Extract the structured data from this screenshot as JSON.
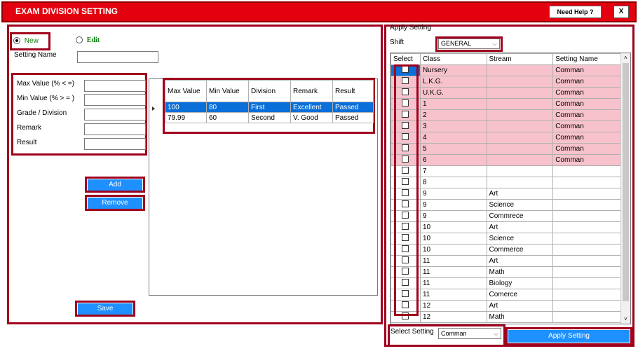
{
  "window": {
    "title": "EXAM DIVISION SETTING",
    "help_label": "Need Help ?",
    "close_label": "X"
  },
  "mode": {
    "new_label": "New",
    "edit_label": "Edit"
  },
  "form": {
    "setting_name_label": "Setting Name",
    "max_value_label": "Max Value  (% < =)",
    "min_value_label": "Min Value   (% > = )",
    "grade_label": "Grade / Division",
    "remark_label": "Remark",
    "result_label": "Result",
    "add_label": "Add",
    "remove_label": "Remove",
    "save_label": "Save"
  },
  "grade_table": {
    "headers": [
      "Max Value",
      "Min Value",
      "Division",
      "Remark",
      "Result"
    ],
    "rows": [
      [
        "100",
        "80",
        "First",
        "Excellent",
        "Passed"
      ],
      [
        "79.99",
        "60",
        "Second",
        "V. Good",
        "Passed"
      ]
    ]
  },
  "apply": {
    "section_label": "Apply Setting",
    "shift_label": "Shift",
    "shift_value": "GENERAL",
    "headers": [
      "Select",
      "Class",
      "Stream",
      "Setting Name"
    ],
    "rows": [
      [
        "Nursery",
        "",
        "Comman"
      ],
      [
        "L.K.G.",
        "",
        "Comman"
      ],
      [
        "U.K.G.",
        "",
        "Comman"
      ],
      [
        "1",
        "",
        "Comman"
      ],
      [
        "2",
        "",
        "Comman"
      ],
      [
        "3",
        "",
        "Comman"
      ],
      [
        "4",
        "",
        "Comman"
      ],
      [
        "5",
        "",
        "Comman"
      ],
      [
        "6",
        "",
        "Comman"
      ],
      [
        "7",
        "",
        ""
      ],
      [
        "8",
        "",
        ""
      ],
      [
        "9",
        "Art",
        ""
      ],
      [
        "9",
        "Science",
        ""
      ],
      [
        "9",
        "Commrece",
        ""
      ],
      [
        "10",
        "Art",
        ""
      ],
      [
        "10",
        "Science",
        ""
      ],
      [
        "10",
        "Commerce",
        ""
      ],
      [
        "11",
        "Art",
        ""
      ],
      [
        "11",
        "Math",
        ""
      ],
      [
        "11",
        "Biology",
        ""
      ],
      [
        "11",
        "Comerce",
        ""
      ],
      [
        "12",
        "Art",
        ""
      ],
      [
        "12",
        "Math",
        ""
      ]
    ],
    "select_setting_label": "Select Setting",
    "select_setting_value": "Comman",
    "apply_button_label": "Apply Setting"
  },
  "colors": {
    "title_bar": "#e3000f",
    "highlight_border": "#a0001c",
    "button_blue": "#1e90ff",
    "row_pink": "#f7c2cc",
    "row_selected": "#0a6fd8"
  }
}
